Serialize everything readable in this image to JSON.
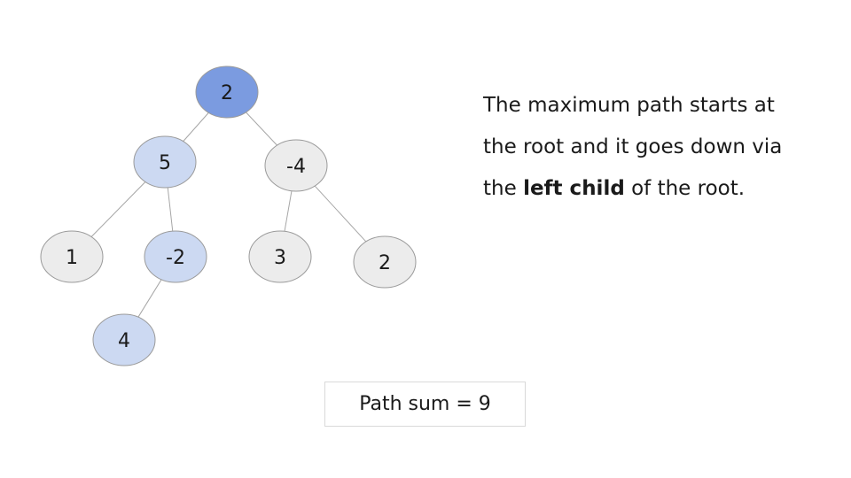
{
  "tree": {
    "nodes": [
      {
        "id": "root",
        "label": "2",
        "state": "root"
      },
      {
        "id": "n5",
        "label": "5",
        "state": "path"
      },
      {
        "id": "nm4",
        "label": "-4",
        "state": "normal"
      },
      {
        "id": "n1",
        "label": "1",
        "state": "normal"
      },
      {
        "id": "nm2",
        "label": "-2",
        "state": "path"
      },
      {
        "id": "n3",
        "label": "3",
        "state": "normal"
      },
      {
        "id": "n2b",
        "label": "2",
        "state": "normal"
      },
      {
        "id": "n4",
        "label": "4",
        "state": "path"
      }
    ],
    "edges": [
      {
        "from": "root",
        "to": "n5"
      },
      {
        "from": "root",
        "to": "nm4"
      },
      {
        "from": "n5",
        "to": "n1"
      },
      {
        "from": "n5",
        "to": "nm2"
      },
      {
        "from": "nm4",
        "to": "n3"
      },
      {
        "from": "nm4",
        "to": "n2b"
      },
      {
        "from": "nm2",
        "to": "n4"
      }
    ]
  },
  "colors": {
    "root_fill": "#7b9be0",
    "path_fill": "#ccd9f2",
    "normal_fill": "#ececec",
    "stroke": "#9a9a9a",
    "edge": "#a6a6a6"
  },
  "explanation": {
    "before": "The maximum path starts at the root and it goes down via the ",
    "bold": "left child",
    "after": " of the root."
  },
  "result": {
    "label": "Path sum = 9"
  }
}
